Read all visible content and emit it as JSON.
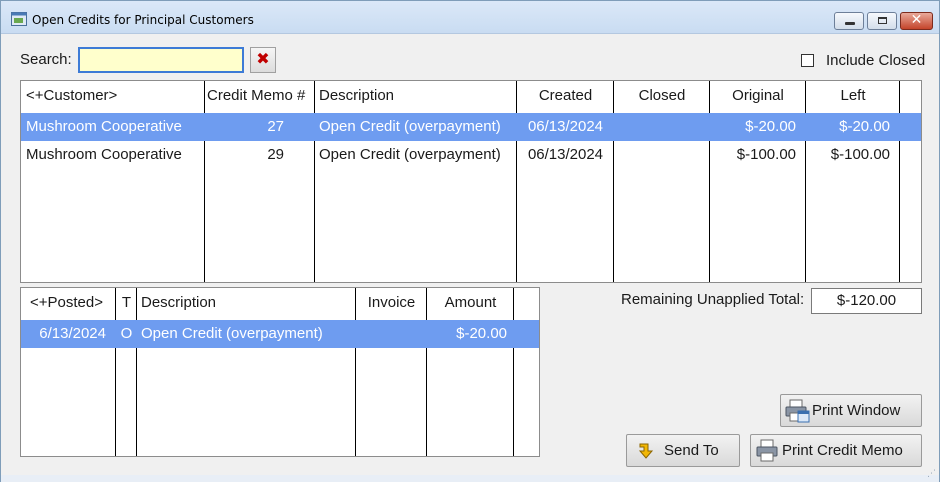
{
  "window": {
    "title": "Open Credits for Principal Customers",
    "icons": {
      "app": "money-window-icon",
      "minimize": "minimize-icon",
      "maximize": "maximize-icon",
      "close": "close-icon"
    }
  },
  "search": {
    "label": "Search:",
    "value": "",
    "placeholder": "",
    "clear_icon": "red-x-icon"
  },
  "include_closed": {
    "label": "Include Closed",
    "checked": false
  },
  "credits_table": {
    "columns": [
      "<+Customer>",
      "Credit Memo #",
      "Description",
      "Created",
      "Closed",
      "Original",
      "Left"
    ],
    "rows": [
      {
        "customer": "Mushroom Cooperative",
        "memo": "27",
        "description": "Open Credit (overpayment)",
        "created": "06/13/2024",
        "closed": "",
        "original": "$-20.00",
        "left": "$-20.00",
        "selected": true
      },
      {
        "customer": "Mushroom Cooperative",
        "memo": "29",
        "description": "Open Credit (overpayment)",
        "created": "06/13/2024",
        "closed": "",
        "original": "$-100.00",
        "left": "$-100.00",
        "selected": false
      }
    ]
  },
  "detail_table": {
    "columns": [
      "<+Posted>",
      "T",
      "Description",
      "Invoice",
      "Amount"
    ],
    "rows": [
      {
        "posted": "6/13/2024",
        "type": "O",
        "description": "Open Credit (overpayment)",
        "invoice": "",
        "amount": "$-20.00",
        "selected": true
      }
    ]
  },
  "remaining": {
    "label": "Remaining Unapplied Total:",
    "value": "$-120.00"
  },
  "buttons": {
    "print_window": {
      "label": "Print Window",
      "icon": "printer-window-icon"
    },
    "send_to": {
      "label": "Send To",
      "icon": "send-arrow-icon"
    },
    "print_credit_memo": {
      "label": "Print Credit Memo",
      "icon": "printer-icon"
    }
  },
  "colors": {
    "selection": "#6e9cf0",
    "search_bg": "#ffffcc",
    "focus_border": "#3d7bd6",
    "close_button": "#c4442a"
  }
}
